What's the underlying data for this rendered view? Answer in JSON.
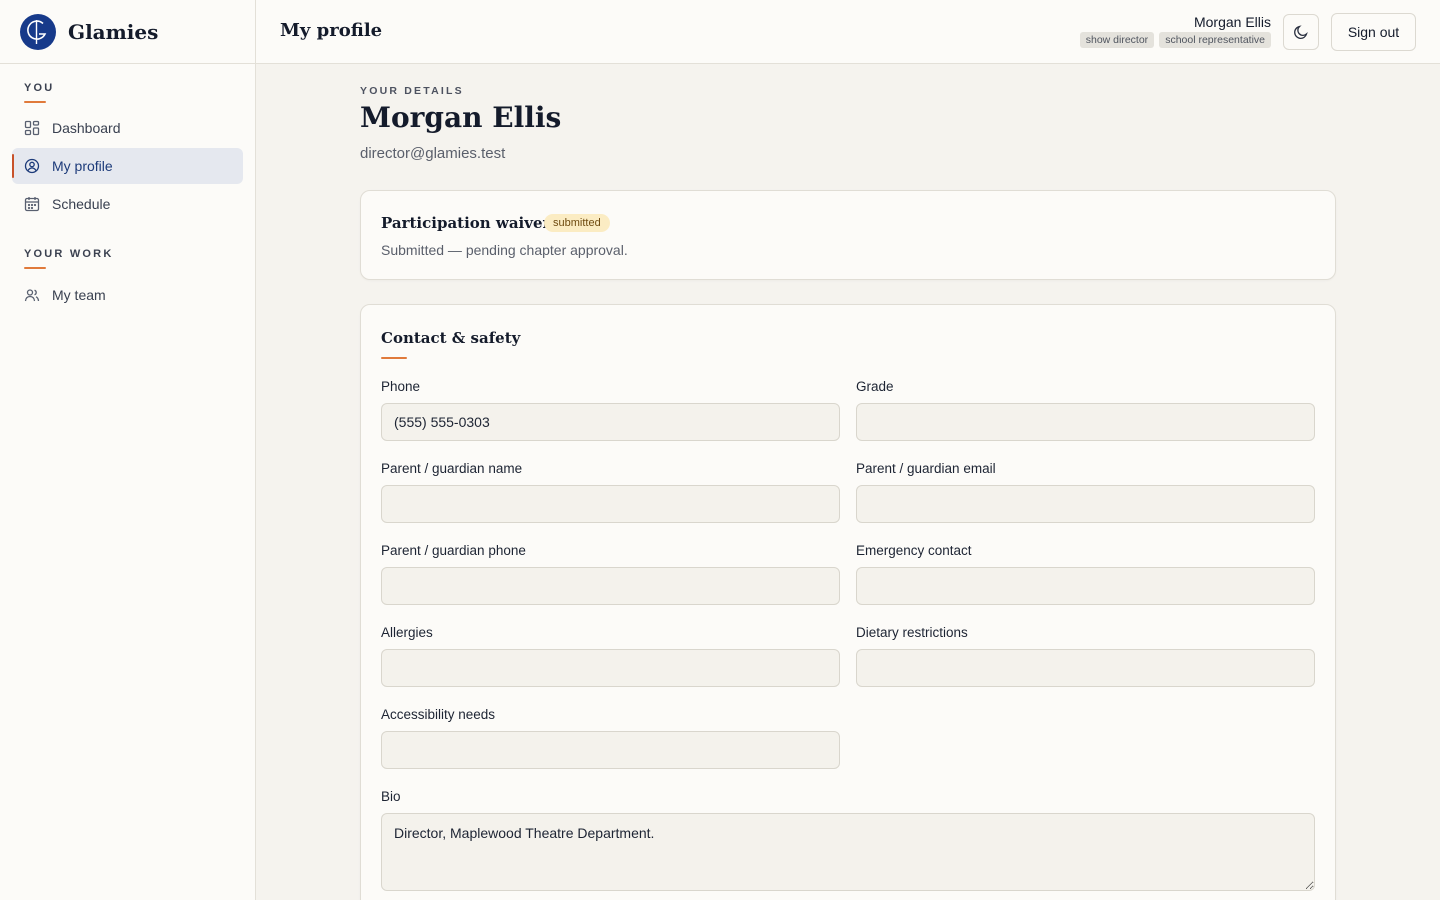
{
  "brand": {
    "name": "Glamies"
  },
  "sidebar": {
    "sections": [
      {
        "label": "YOU",
        "items": [
          {
            "label": "Dashboard",
            "icon": "dashboard-grid-icon"
          },
          {
            "label": "My profile",
            "icon": "user-circle-icon",
            "active": true
          },
          {
            "label": "Schedule",
            "icon": "calendar-icon"
          }
        ]
      },
      {
        "label": "YOUR WORK",
        "items": [
          {
            "label": "My team",
            "icon": "users-icon"
          }
        ]
      }
    ]
  },
  "header": {
    "title": "My profile",
    "user_name": "Morgan Ellis",
    "roles": [
      "show director",
      "school representative"
    ],
    "theme_toggle_icon": "moon-icon",
    "sign_out_label": "Sign out"
  },
  "profile": {
    "eyebrow": "YOUR DETAILS",
    "name": "Morgan Ellis",
    "email": "director@glamies.test"
  },
  "waiver": {
    "title": "Participation waiver",
    "status": "submitted",
    "message": "Submitted — pending chapter approval."
  },
  "contact": {
    "title": "Contact & safety",
    "fields": {
      "phone": {
        "label": "Phone",
        "value": "(555) 555-0303"
      },
      "grade": {
        "label": "Grade",
        "value": ""
      },
      "guardian_name": {
        "label": "Parent / guardian name",
        "value": ""
      },
      "guardian_email": {
        "label": "Parent / guardian email",
        "value": ""
      },
      "guardian_phone": {
        "label": "Parent / guardian phone",
        "value": ""
      },
      "emergency_contact": {
        "label": "Emergency contact",
        "value": ""
      },
      "allergies": {
        "label": "Allergies",
        "value": ""
      },
      "dietary": {
        "label": "Dietary restrictions",
        "value": ""
      },
      "accessibility": {
        "label": "Accessibility needs",
        "value": ""
      },
      "bio": {
        "label": "Bio",
        "value": "Director, Maplewood Theatre Department."
      }
    }
  },
  "colors": {
    "accent": "#e07a3b",
    "brand": "#173a8a",
    "active_nav_bg": "#e5e8ef",
    "badge_bg": "#fbecc3"
  }
}
